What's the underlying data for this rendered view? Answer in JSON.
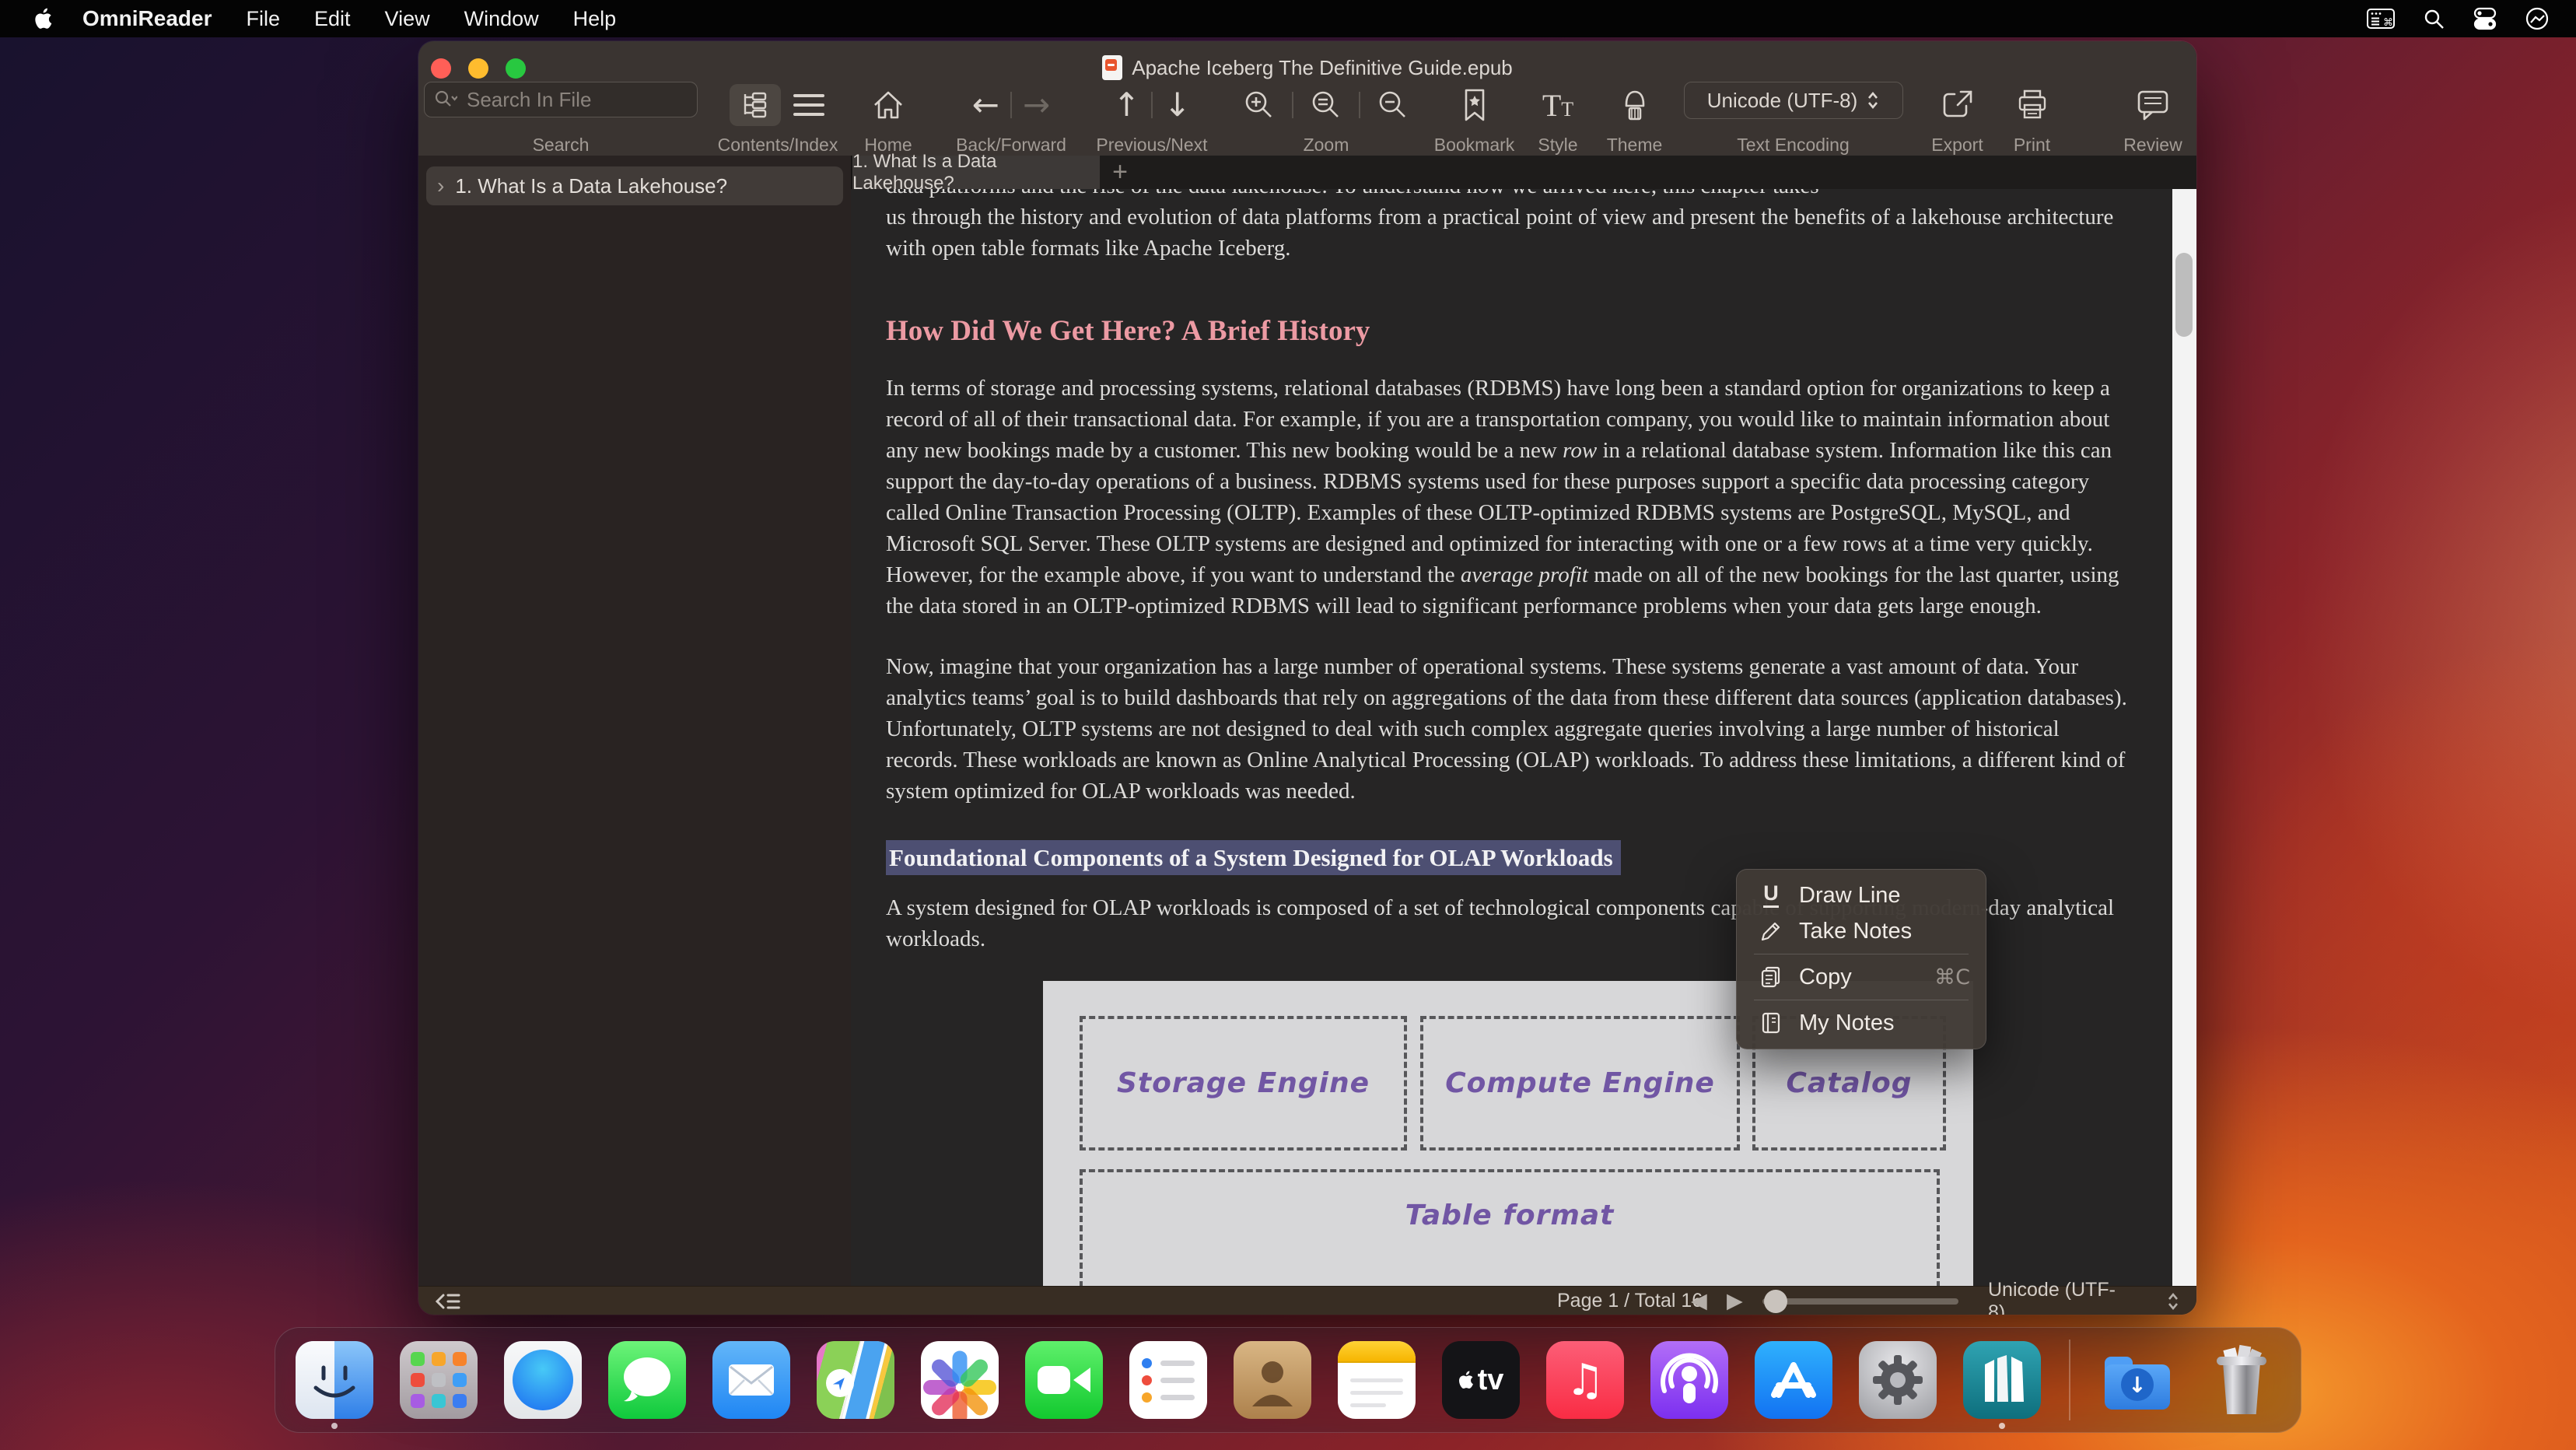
{
  "menu_bar": {
    "app_name": "OmniReader",
    "menus": [
      "File",
      "Edit",
      "View",
      "Window",
      "Help"
    ],
    "status_icons": [
      "keyboard-input-menu",
      "spotlight-search",
      "control-center",
      "clock-status"
    ]
  },
  "window": {
    "title": "Apache Iceberg The Definitive Guide.epub",
    "toolbar": {
      "search_placeholder": "Search In File",
      "text_encoding_value": "Unicode  (UTF-8)",
      "labels": {
        "search": "Search",
        "contents": "Contents/Index",
        "home": "Home",
        "back_forward": "Back/Forward",
        "previous_next": "Previous/Next",
        "zoom": "Zoom",
        "bookmark": "Bookmark",
        "style": "Style",
        "theme": "Theme",
        "text_encoding": "Text Encoding",
        "export": "Export",
        "print": "Print",
        "review": "Review"
      }
    },
    "tab_bar": {
      "active_tab": "1. What Is a Data Lakehouse?",
      "new_tab": "+"
    },
    "sidebar": {
      "items": [
        {
          "chevron": "›",
          "label": "1. What Is a Data Lakehouse?"
        }
      ]
    },
    "content": {
      "clipped_line": "data platforms and the rise of the data lakehouse. To understand how we arrived here, this chapter takes",
      "intro_continuation": "us through the history and evolution of data platforms from a practical point of view and present the benefits of a lakehouse architecture with open table formats like Apache Iceberg.",
      "heading_history": "How Did We Get Here? A Brief History",
      "para_history_segments": [
        {
          "text": "In terms of storage and processing systems, relational databases (RDBMS) have long been a standard option for organizations to keep a record of all of their transactional data. For example, if you are a transportation company, you would like to maintain information about any new bookings made by a customer. This new booking would be a new ",
          "italic": false
        },
        {
          "text": "row",
          "italic": true
        },
        {
          "text": " in a relational database system. Information like this can support the day-to-day operations of a business. RDBMS systems used for these purposes support a specific data processing category called Online Transaction Processing (OLTP). Examples of these OLTP-optimized RDBMS systems are PostgreSQL, MySQL, and Microsoft SQL Server. These OLTP systems are designed and optimized for interacting with one or a few rows at a time very quickly. However, for the example above, if you want to understand the ",
          "italic": false
        },
        {
          "text": "average profit",
          "italic": true
        },
        {
          "text": " made on all of the new bookings for the last quarter, using the data stored in an OLTP-optimized RDBMS will lead to significant performance problems when your data gets large enough.",
          "italic": false
        }
      ],
      "para_olap": "Now, imagine that your organization has a large number of operational systems. These systems generate a vast amount of data. Your analytics teams’ goal is to build dashboards that rely on aggregations of the data from these different data sources (application databases). Unfortunately, OLTP systems are not designed to deal with such complex aggregate queries involving a large number of historical records. These workloads are known as Online Analytical Processing (OLAP) workloads. To address these limitations, a different kind of system optimized for OLAP workloads was needed.",
      "heading_foundational": "Foundational Components of a System Designed for OLAP Workloads",
      "para_components": "A system designed for OLAP workloads is composed of a set of technological components capable of supporting modern-day analytical workloads.",
      "figure": {
        "boxes": [
          "Storage Engine",
          "Compute Engine",
          "Catalog"
        ],
        "bottom_box": "Table format"
      }
    },
    "context_menu": {
      "items": [
        {
          "label": "Draw Line"
        },
        {
          "label": "Take Notes"
        },
        {
          "label": "Copy",
          "shortcut": "⌘C"
        },
        {
          "label": "My Notes"
        }
      ]
    },
    "status_bar": {
      "page_info": "Page 1 / Total 16",
      "prev": "◀",
      "next": "▶",
      "encoding": "Unicode  (UTF-8)"
    }
  },
  "glyphs": {
    "back": "←",
    "forward": "→",
    "up": "↑",
    "down": "↓",
    "underline_u": "U",
    "music_note": "♫",
    "tv_label": "tv",
    "style_t_big": "T",
    "style_t_small": "T",
    "download_arrow": "↓"
  },
  "colors": {
    "heading_pink": "#ec9aa3",
    "selection_highlight": "#4d4f72",
    "figure_label_purple": "#7156a4",
    "toolbar_bg": "#3a3431"
  },
  "dock": {
    "apps": [
      "finder",
      "launchpad",
      "safari",
      "messages",
      "mail",
      "maps",
      "photos",
      "facetime",
      "reminders",
      "contacts",
      "notes",
      "apple-tv",
      "music",
      "podcasts",
      "app-store",
      "system-settings",
      "omnireader",
      "downloads",
      "trash"
    ],
    "running_apps": [
      "finder",
      "omnireader"
    ]
  }
}
